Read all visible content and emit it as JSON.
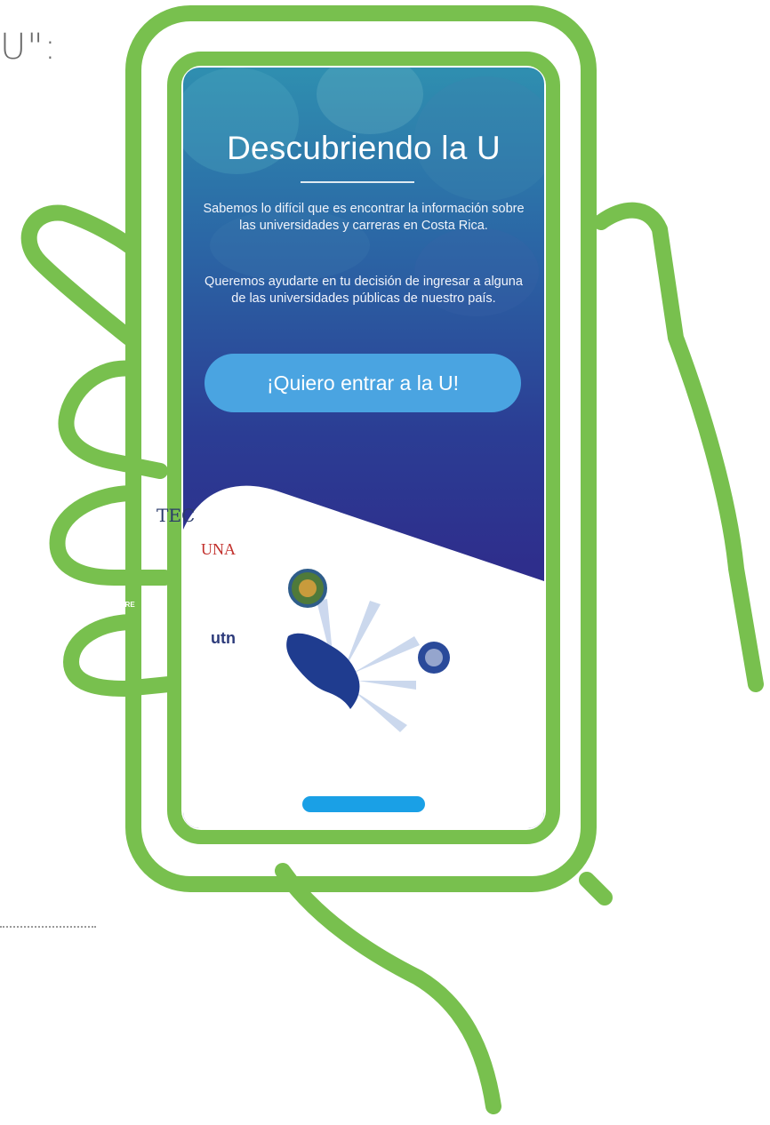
{
  "page": {
    "fragment_text": "U\":"
  },
  "app": {
    "title": "Descubriendo la U",
    "intro_paragraph_1": "Sabemos lo difícil que es encontrar la información sobre las universidades y carreras en Costa Rica.",
    "intro_paragraph_2": "Queremos ayudarte en tu decisión de ingresar a alguna de las universidades públicas de nuestro país.",
    "cta_label": "¡Quiero entrar a la U!"
  },
  "logos": {
    "tec": "TEC",
    "una": "UNA",
    "conare": "CONARE",
    "utn": "utn"
  },
  "colors": {
    "outline_green": "#78c04e",
    "cta_blue": "#4aa4e1",
    "indicator_blue": "#1aa0e6",
    "screen_top": "#2f8fb0",
    "screen_bottom": "#2f2a8a"
  },
  "icons": {
    "hand": "hand-outline-icon",
    "phone": "phone-outline-icon",
    "map": "costa-rica-map-icon",
    "ucr_seal": "ucr-seal-icon",
    "uned_seal": "uned-seal-icon"
  }
}
